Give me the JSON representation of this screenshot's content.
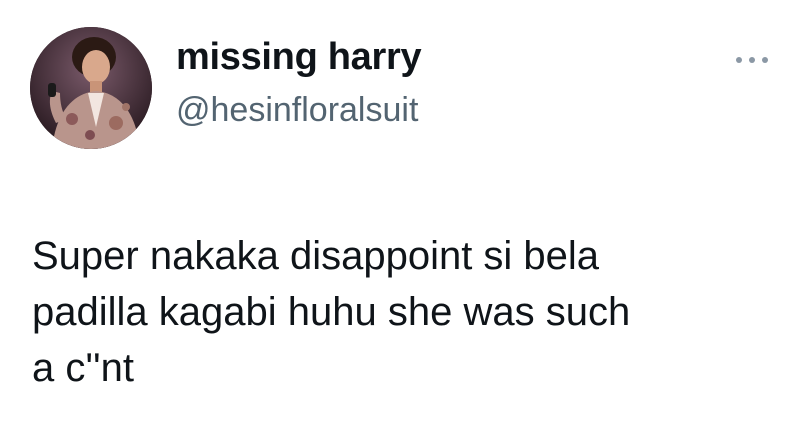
{
  "author": {
    "display_name": "missing harry",
    "handle": "@hesinfloralsuit",
    "avatar_icon": "profile-photo-icon"
  },
  "menu": {
    "icon": "more-options-icon"
  },
  "tweet": {
    "lines": [
      "Super nakaka disappoint si bela",
      "padilla kagabi huhu she was such",
      "a c''nt"
    ]
  },
  "colors": {
    "text": "#0f1419",
    "secondary": "#536471",
    "menu_dots": "#8b98a5",
    "background": "#ffffff"
  }
}
